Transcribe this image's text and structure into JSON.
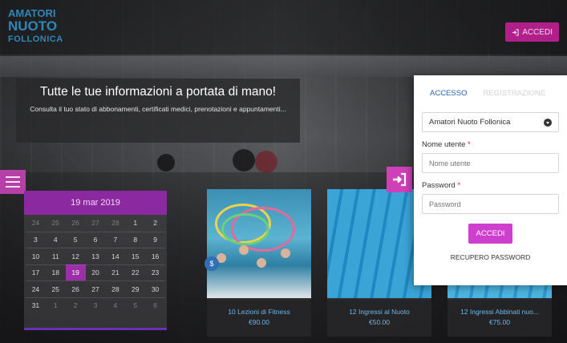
{
  "logo": {
    "line1": "AMATORI",
    "line2": "NUOTO",
    "line3": "FOLLONICA"
  },
  "header": {
    "login_button": "ACCEDI"
  },
  "hero": {
    "title": "Tutte le tue informazioni a portata di mano!",
    "subtitle": "Consulta il tuo stato di abbonamenti, certificati medici, prenotazioni e appuntamenti..."
  },
  "calendar": {
    "header": "19 mar 2019",
    "weeks": [
      [
        "24",
        "25",
        "26",
        "27",
        "28",
        "1",
        "2"
      ],
      [
        "3",
        "4",
        "5",
        "6",
        "7",
        "8",
        "9"
      ],
      [
        "10",
        "11",
        "12",
        "13",
        "14",
        "15",
        "16"
      ],
      [
        "17",
        "18",
        "19",
        "20",
        "21",
        "22",
        "23"
      ],
      [
        "24",
        "25",
        "26",
        "27",
        "28",
        "29",
        "30"
      ],
      [
        "31",
        "1",
        "2",
        "3",
        "4",
        "5",
        "6"
      ]
    ],
    "selected": "19"
  },
  "cards": [
    {
      "title": "10 Lezioni di Fitness",
      "price": "€90.00"
    },
    {
      "title": "12 Ingressi al Nuoto",
      "price": "€50.00"
    },
    {
      "title": "12 Ingressi Abbinati nuo...",
      "price": "€75.00"
    }
  ],
  "login": {
    "tab_access": "ACCESSO",
    "tab_register": "REGISTRAZIONE",
    "club_select": "Amatori Nuoto Follonica",
    "username_label": "Nome utente",
    "username_placeholder": "Nome utente",
    "password_label": "Password",
    "password_placeholder": "Password",
    "required_mark": "*",
    "submit_label": "ACCEDI",
    "recover_label": "RECUPERO PASSWORD"
  },
  "colors": {
    "brand": "#cf3fcf",
    "tab_active": "#2a5fb0",
    "calendar_header": "#8b2aa0",
    "card_caption": "#6fb6e6"
  }
}
